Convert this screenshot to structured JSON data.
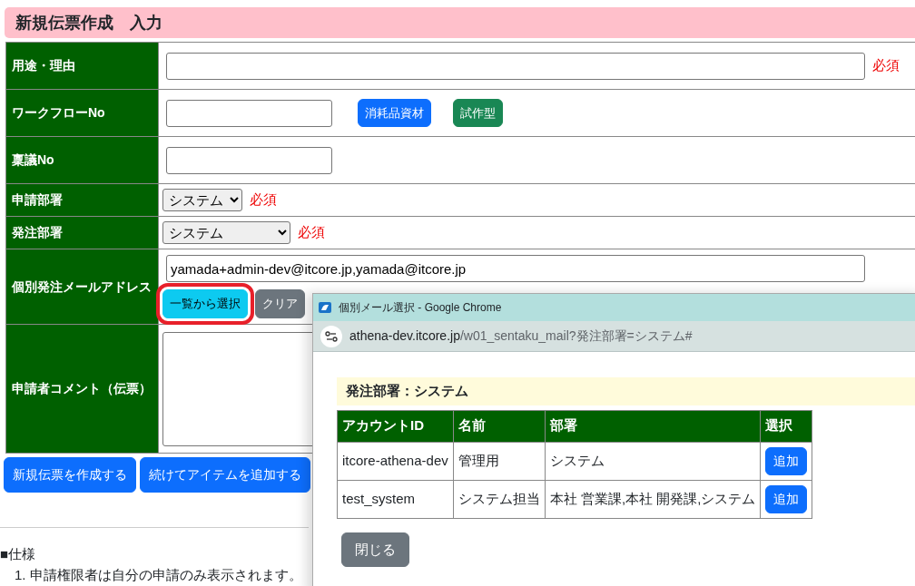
{
  "page_title": "新規伝票作成　入力",
  "form_rows": [
    {
      "kind": "wide-input",
      "label": "用途・理由",
      "required_note": "必須"
    },
    {
      "kind": "short-input",
      "label": "ワークフローNo",
      "buttons": [
        {
          "label": "消耗品資材"
        },
        {
          "label": "試作型"
        }
      ]
    },
    {
      "kind": "short-input",
      "label": "稟議No"
    },
    {
      "kind": "select-compact",
      "label": "申請部署",
      "value": "システム",
      "required_note": "必須"
    },
    {
      "kind": "select",
      "label": "発注部署",
      "value": "システム",
      "required_note": "必須"
    },
    {
      "kind": "email",
      "label": "個別発注メールアドレス",
      "value": "yamada+admin-dev@itcore.jp,yamada@itcore.jp",
      "buttons": [
        {
          "label": "一覧から選択",
          "highlighted": true
        },
        {
          "label": "クリア",
          "highlighted": false
        }
      ]
    },
    {
      "kind": "textarea",
      "label": "申請者コメント（伝票）"
    }
  ],
  "actions": [
    {
      "label": "新規伝票を作成する"
    },
    {
      "label": "続けてアイテムを追加する"
    }
  ],
  "spec": {
    "heading": "■仕様",
    "items": [
      {
        "number": "1.",
        "text": "申請権限者は自分の申請のみ表示されます。"
      }
    ]
  },
  "popup": {
    "window_title": "個別メール選択 - Google Chrome",
    "url_host": "athena-dev.itcore.jp",
    "url_path": "/w01_sentaku_mail?発注部署=システム#",
    "heading": "発注部署：システム",
    "columns": [
      "アカウントID",
      "名前",
      "部署",
      "選択"
    ],
    "rows": [
      {
        "account_id": "itcore-athena-dev",
        "name": "管理用",
        "department": "システム",
        "action": "追加"
      },
      {
        "account_id": "test_system",
        "name": "システム担当",
        "department": "本社 営業課,本社 開発課,システム",
        "action": "追加"
      }
    ],
    "close_button": "閉じる"
  }
}
